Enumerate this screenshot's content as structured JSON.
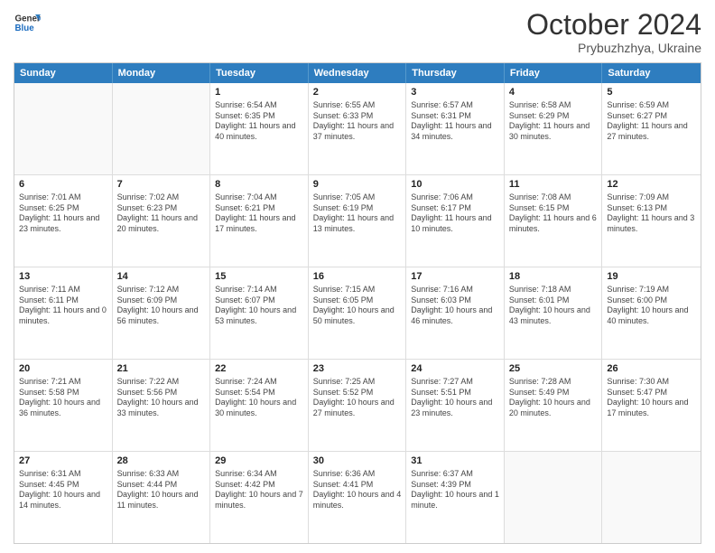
{
  "header": {
    "logo_line1": "General",
    "logo_line2": "Blue",
    "month": "October 2024",
    "location": "Prybuzhzhya, Ukraine"
  },
  "weekdays": [
    "Sunday",
    "Monday",
    "Tuesday",
    "Wednesday",
    "Thursday",
    "Friday",
    "Saturday"
  ],
  "rows": [
    [
      {
        "day": "",
        "info": ""
      },
      {
        "day": "",
        "info": ""
      },
      {
        "day": "1",
        "info": "Sunrise: 6:54 AM\nSunset: 6:35 PM\nDaylight: 11 hours and 40 minutes."
      },
      {
        "day": "2",
        "info": "Sunrise: 6:55 AM\nSunset: 6:33 PM\nDaylight: 11 hours and 37 minutes."
      },
      {
        "day": "3",
        "info": "Sunrise: 6:57 AM\nSunset: 6:31 PM\nDaylight: 11 hours and 34 minutes."
      },
      {
        "day": "4",
        "info": "Sunrise: 6:58 AM\nSunset: 6:29 PM\nDaylight: 11 hours and 30 minutes."
      },
      {
        "day": "5",
        "info": "Sunrise: 6:59 AM\nSunset: 6:27 PM\nDaylight: 11 hours and 27 minutes."
      }
    ],
    [
      {
        "day": "6",
        "info": "Sunrise: 7:01 AM\nSunset: 6:25 PM\nDaylight: 11 hours and 23 minutes."
      },
      {
        "day": "7",
        "info": "Sunrise: 7:02 AM\nSunset: 6:23 PM\nDaylight: 11 hours and 20 minutes."
      },
      {
        "day": "8",
        "info": "Sunrise: 7:04 AM\nSunset: 6:21 PM\nDaylight: 11 hours and 17 minutes."
      },
      {
        "day": "9",
        "info": "Sunrise: 7:05 AM\nSunset: 6:19 PM\nDaylight: 11 hours and 13 minutes."
      },
      {
        "day": "10",
        "info": "Sunrise: 7:06 AM\nSunset: 6:17 PM\nDaylight: 11 hours and 10 minutes."
      },
      {
        "day": "11",
        "info": "Sunrise: 7:08 AM\nSunset: 6:15 PM\nDaylight: 11 hours and 6 minutes."
      },
      {
        "day": "12",
        "info": "Sunrise: 7:09 AM\nSunset: 6:13 PM\nDaylight: 11 hours and 3 minutes."
      }
    ],
    [
      {
        "day": "13",
        "info": "Sunrise: 7:11 AM\nSunset: 6:11 PM\nDaylight: 11 hours and 0 minutes."
      },
      {
        "day": "14",
        "info": "Sunrise: 7:12 AM\nSunset: 6:09 PM\nDaylight: 10 hours and 56 minutes."
      },
      {
        "day": "15",
        "info": "Sunrise: 7:14 AM\nSunset: 6:07 PM\nDaylight: 10 hours and 53 minutes."
      },
      {
        "day": "16",
        "info": "Sunrise: 7:15 AM\nSunset: 6:05 PM\nDaylight: 10 hours and 50 minutes."
      },
      {
        "day": "17",
        "info": "Sunrise: 7:16 AM\nSunset: 6:03 PM\nDaylight: 10 hours and 46 minutes."
      },
      {
        "day": "18",
        "info": "Sunrise: 7:18 AM\nSunset: 6:01 PM\nDaylight: 10 hours and 43 minutes."
      },
      {
        "day": "19",
        "info": "Sunrise: 7:19 AM\nSunset: 6:00 PM\nDaylight: 10 hours and 40 minutes."
      }
    ],
    [
      {
        "day": "20",
        "info": "Sunrise: 7:21 AM\nSunset: 5:58 PM\nDaylight: 10 hours and 36 minutes."
      },
      {
        "day": "21",
        "info": "Sunrise: 7:22 AM\nSunset: 5:56 PM\nDaylight: 10 hours and 33 minutes."
      },
      {
        "day": "22",
        "info": "Sunrise: 7:24 AM\nSunset: 5:54 PM\nDaylight: 10 hours and 30 minutes."
      },
      {
        "day": "23",
        "info": "Sunrise: 7:25 AM\nSunset: 5:52 PM\nDaylight: 10 hours and 27 minutes."
      },
      {
        "day": "24",
        "info": "Sunrise: 7:27 AM\nSunset: 5:51 PM\nDaylight: 10 hours and 23 minutes."
      },
      {
        "day": "25",
        "info": "Sunrise: 7:28 AM\nSunset: 5:49 PM\nDaylight: 10 hours and 20 minutes."
      },
      {
        "day": "26",
        "info": "Sunrise: 7:30 AM\nSunset: 5:47 PM\nDaylight: 10 hours and 17 minutes."
      }
    ],
    [
      {
        "day": "27",
        "info": "Sunrise: 6:31 AM\nSunset: 4:45 PM\nDaylight: 10 hours and 14 minutes."
      },
      {
        "day": "28",
        "info": "Sunrise: 6:33 AM\nSunset: 4:44 PM\nDaylight: 10 hours and 11 minutes."
      },
      {
        "day": "29",
        "info": "Sunrise: 6:34 AM\nSunset: 4:42 PM\nDaylight: 10 hours and 7 minutes."
      },
      {
        "day": "30",
        "info": "Sunrise: 6:36 AM\nSunset: 4:41 PM\nDaylight: 10 hours and 4 minutes."
      },
      {
        "day": "31",
        "info": "Sunrise: 6:37 AM\nSunset: 4:39 PM\nDaylight: 10 hours and 1 minute."
      },
      {
        "day": "",
        "info": ""
      },
      {
        "day": "",
        "info": ""
      }
    ]
  ]
}
